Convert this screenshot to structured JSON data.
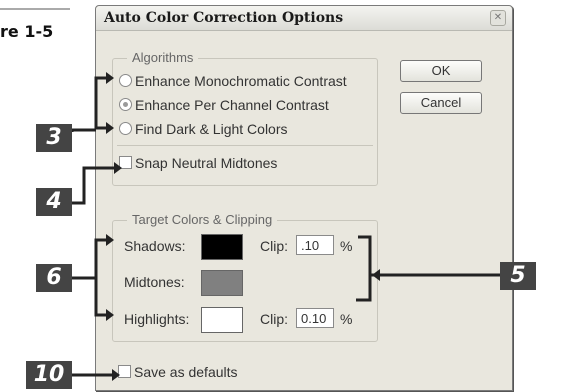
{
  "figure": {
    "label": "re 1-5"
  },
  "dialog": {
    "title": "Auto Color Correction Options",
    "algorithms": {
      "legend": "Algorithms",
      "options": [
        {
          "label": "Enhance Monochromatic Contrast",
          "selected": false
        },
        {
          "label": "Enhance Per Channel Contrast",
          "selected": true
        },
        {
          "label": "Find Dark & Light Colors",
          "selected": false
        }
      ],
      "snap_label": "Snap Neutral Midtones",
      "snap_checked": false
    },
    "buttons": {
      "ok": "OK",
      "cancel": "Cancel"
    },
    "target": {
      "legend": "Target Colors & Clipping",
      "shadows_label": "Shadows:",
      "shadows_color": "#000000",
      "midtones_label": "Midtones:",
      "midtones_color": "#808080",
      "highlights_label": "Highlights:",
      "highlights_color": "#ffffff",
      "clip_label": "Clip:",
      "shadows_clip": ".10",
      "highlights_clip": "0.10",
      "percent": "%"
    },
    "save_defaults_label": "Save as defaults",
    "save_defaults_checked": false
  },
  "callouts": {
    "c3": "3",
    "c4": "4",
    "c6": "6",
    "c5": "5",
    "c10": "10"
  },
  "icons": {
    "close": "close-icon"
  }
}
